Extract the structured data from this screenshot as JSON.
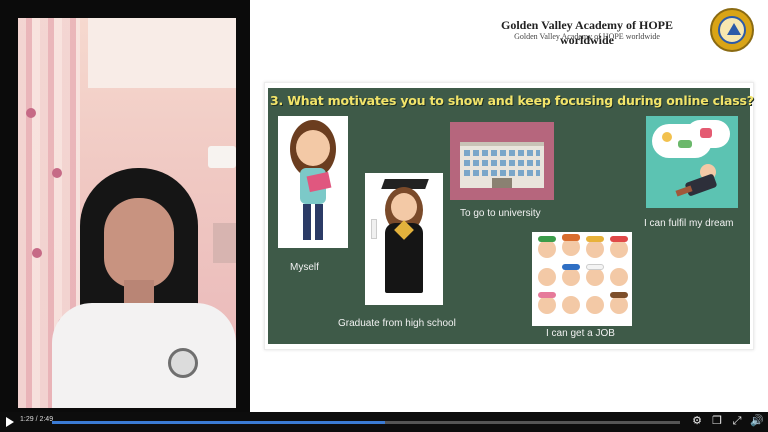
{
  "header": {
    "title": "Golden Valley Academy of HOPE worldwide",
    "subtitle": "Golden Valley Academy of HOPE worldwide"
  },
  "slide": {
    "question": "3. What motivates you to show and keep focusing during online class?",
    "items": [
      {
        "label": "Myself",
        "icon": "girl-holding-book-icon"
      },
      {
        "label": "Graduate from high school",
        "icon": "graduate-girl-icon"
      },
      {
        "label": "To go to university",
        "icon": "university-building-icon"
      },
      {
        "label": "I can get a JOB",
        "icon": "professions-grid-icon"
      },
      {
        "label": "I can fulfil my dream",
        "icon": "dreaming-man-icon"
      }
    ],
    "colors": {
      "board": "#3e5a48",
      "question": "#f2e46a"
    }
  },
  "player": {
    "time": "1:29 / 2:49",
    "progress_percent": 53,
    "accent": "#3b7bd4"
  }
}
